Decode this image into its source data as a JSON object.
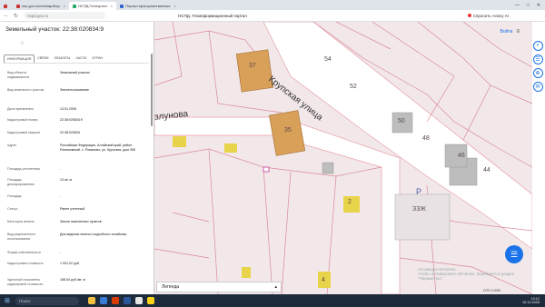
{
  "browser": {
    "tabs": [
      {
        "label": "",
        "active": false
      },
      {
        "label": "nsc.gov.ru/ext/map/ll/cp",
        "active": false
      },
      {
        "label": "НСПД Геопортал",
        "active": true
      },
      {
        "label": "Портал пространственных",
        "active": false
      }
    ],
    "url": "nspd.gov.ru",
    "page_title": "НСПД. Геоинформационный портал",
    "ask_label": "Спросить Алису AI"
  },
  "panel": {
    "heading": "Земельный участок: 22:38:020834:9",
    "tabs": [
      "ИНФОРМАЦИЯ",
      "СВЯЗИ",
      "ОБЪЕКТЫ",
      "ЧАСТИ",
      "ОГРАН"
    ],
    "rows": [
      {
        "k": "Вид объекта недвижимости",
        "v": "Земельный участок"
      },
      {
        "k": "Вид земельного участка",
        "v": "Землепользование"
      },
      {
        "k": "Дата присвоения",
        "v": "13.01.2005"
      },
      {
        "k": "Кадастровый номер",
        "v": "22:38:020834:9"
      },
      {
        "k": "Кадастровый квартал",
        "v": "22:38:020834"
      },
      {
        "k": "Адрес",
        "v": "Российская Федерация, Алтайский край, район Романовский, с. Романово, ул. Крупская, дом 35б"
      },
      {
        "k": "Площадь уточненная",
        "v": "-"
      },
      {
        "k": "Площадь декларированная",
        "v": "13 кв. м"
      },
      {
        "k": "Площадь",
        "v": "-"
      },
      {
        "k": "Статус",
        "v": "Ранее учтенный"
      },
      {
        "k": "Категория земель",
        "v": "Земли населенных пунктов"
      },
      {
        "k": "Вид разрешенного использования",
        "v": "Для ведения личного подсобного хозяйства"
      },
      {
        "k": "Форма собственности",
        "v": "-"
      },
      {
        "k": "Кадастровая стоимость",
        "v": "1 001,02 руб."
      },
      {
        "k": "Удельный показатель кадастровой стоимости",
        "v": "188,54 руб./кв. м"
      }
    ]
  },
  "map": {
    "street_name": "Крупская улица",
    "street_partial": "злунова",
    "parcels": [
      "37",
      "54",
      "52",
      "50",
      "35",
      "48",
      "46",
      "44",
      "2",
      "ЗЗЖ",
      "4"
    ],
    "top_link": "Войти",
    "legend_label": "Легенда",
    "watermark": "Активация Windows\nЧтобы активировать Windows, перейдите в раздел \"Параметры\".",
    "scale": "СПЗ 1:1000"
  },
  "taskbar": {
    "search_placeholder": "Поиск",
    "time": "13:12",
    "date": "10.12.2025"
  },
  "colors": {
    "parcel_fill": "#d9a05a",
    "yellow_fill": "#e8d44a",
    "road": "#ffffff",
    "accent": "#1a73e8"
  }
}
